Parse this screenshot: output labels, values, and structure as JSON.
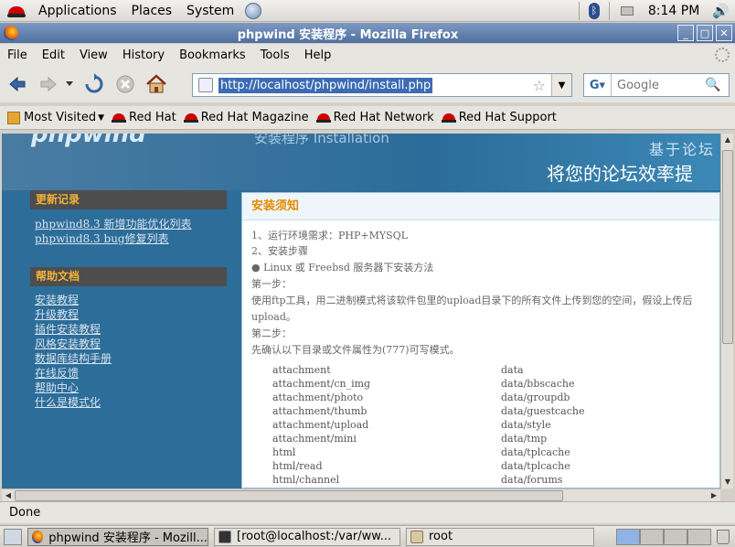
{
  "top_panel": {
    "menus": [
      "Applications",
      "Places",
      "System"
    ],
    "clock": "8:14 PM"
  },
  "window": {
    "title": "phpwind 安装程序 - Mozilla Firefox"
  },
  "menubar": {
    "items": [
      "File",
      "Edit",
      "View",
      "History",
      "Bookmarks",
      "Tools",
      "Help"
    ]
  },
  "navbar": {
    "url": "http://localhost/phpwind/install.php",
    "search_placeholder": "Google"
  },
  "bookmarks": {
    "most_visited": "Most Visited",
    "items": [
      "Red Hat",
      "Red Hat Magazine",
      "Red Hat Network",
      "Red Hat Support"
    ]
  },
  "page": {
    "logo": "phpwind",
    "install_title": "安装程序 Installation",
    "slogan_line1": "基于论坛",
    "slogan_line2": "将您的论坛效率提",
    "sidebar": {
      "updates_title": "更新记录",
      "updates_links": [
        "phpwind8.3 新增功能优化列表",
        "phpwind8.3 bug修复列表"
      ],
      "help_title": "帮助文档",
      "help_links": [
        "安装教程",
        "升级教程",
        "插件安装教程",
        "风格安装教程",
        "数据库结构手册",
        "在线反馈",
        "帮助中心",
        "什么是模式化"
      ]
    },
    "main": {
      "heading": "安装须知",
      "line1": "1、运行环境需求：PHP+MYSQL",
      "line2": "2、安装步骤",
      "line3": "● Linux 或 Freebsd 服务器下安装方法",
      "step1": "第一步：",
      "step1_text": "使用ftp工具，用二进制模式将该软件包里的upload目录下的所有文件上传到您的空间，假设上传后",
      "step1_text2": "upload。",
      "step2": "第二步：",
      "step2_text": "先确认以下目录或文件属性为(777)可写模式。",
      "dirs_left": [
        "attachment",
        "attachment/cn_img",
        "attachment/photo",
        "attachment/thumb",
        "attachment/upload",
        "attachment/mini",
        "html",
        "html/read",
        "html/channel"
      ],
      "dirs_right": [
        "data",
        "data/bbscache",
        "data/groupdb",
        "data/guestcache",
        "data/style",
        "data/tmp",
        "data/tplcache",
        "data/tplcache",
        "data/forums"
      ]
    }
  },
  "statusbar": {
    "text": "Done"
  },
  "taskbar": {
    "tasks": [
      "phpwind 安装程序 - Mozill...",
      "[root@localhost:/var/ww...",
      "root"
    ]
  }
}
